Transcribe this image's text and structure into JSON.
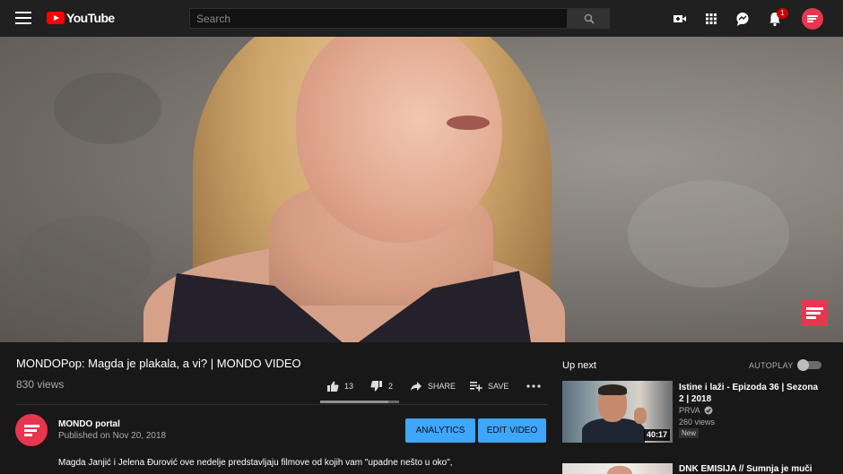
{
  "header": {
    "logo_text": "YouTube",
    "search_placeholder": "Search",
    "notification_count": "1",
    "icons": [
      "menu-icon",
      "create-video-icon",
      "apps-icon",
      "messages-icon",
      "notifications-icon"
    ]
  },
  "video": {
    "title": "MONDOPop: Magda je plakala, a vi? | MONDO VIDEO",
    "views": "830 views",
    "likes": "13",
    "dislikes": "2",
    "share_label": "SHARE",
    "save_label": "SAVE",
    "like_ratio": 0.867
  },
  "channel": {
    "name": "MONDO portal",
    "published": "Published on Nov 20, 2018",
    "analytics_label": "ANALYTICS",
    "edit_label": "EDIT VIDEO"
  },
  "description": "Magda Janjić i Jelena Đurović ove nedelje predstavljaju filmove od kojih vam \"upadne nešto u oko\",",
  "up_next": {
    "label": "Up next",
    "autoplay_label": "AUTOPLAY",
    "autoplay_on": false,
    "items": [
      {
        "title": "Istine i laži - Epizoda 36 | Sezona 2 | 2018",
        "channel": "PRVA",
        "verified": true,
        "views": "260 views",
        "badge": "New",
        "duration": "40:17"
      },
      {
        "title": "DNK EMISIJA // Sumnja je muči"
      }
    ]
  },
  "colors": {
    "brand_red": "#ff0000",
    "channel_pink": "#e8364f",
    "button_blue": "#3ea6ff",
    "background": "#181818"
  }
}
